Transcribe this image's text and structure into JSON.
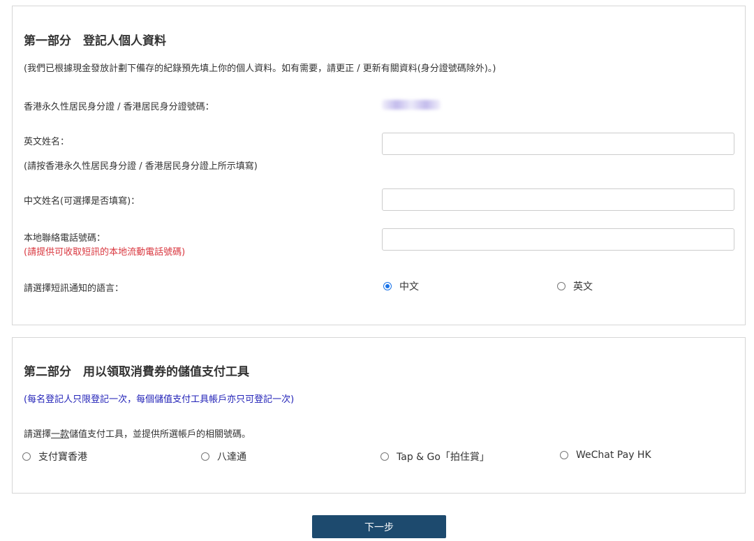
{
  "section1": {
    "title": "第一部分　登記人個人資料",
    "note": "(我們已根據現金發放計劃下備存的紀錄預先填上你的個人資料。如有需要，請更正 / 更新有關資料(身分證號碼除外)。)",
    "id_label": "香港永久性居民身分證 / 香港居民身分證號碼：",
    "english_name_label": "英文姓名：",
    "english_name_hint": "(請按香港永久性居民身分證 / 香港居民身分證上所示填寫)",
    "english_name_value": "",
    "chinese_name_label": "中文姓名(可選擇是否填寫)：",
    "chinese_name_value": "",
    "phone_label": "本地聯絡電話號碼：",
    "phone_hint": "(請提供可收取短訊的本地流動電話號碼)",
    "phone_value": "",
    "sms_language_label": "請選擇短訊通知的語言：",
    "sms_language_options": [
      "中文",
      "英文"
    ],
    "sms_language_selected": "中文"
  },
  "section2": {
    "title": "第二部分　用以領取消費券的儲值支付工具",
    "note": "(每名登記人只限登記一次，每個儲值支付工具帳戶亦只可登記一次)",
    "instruction_pre": "請選擇",
    "instruction_emph": "一款",
    "instruction_post": "儲值支付工具，並提供所選帳戶的相關號碼。",
    "payment_options": [
      "支付寶香港",
      "八達通",
      "Tap & Go「拍住賞」",
      "WeChat Pay HK"
    ]
  },
  "next_button": "下一步",
  "colors": {
    "accent_button": "#1d4a6e",
    "warning_text": "#d9363e",
    "info_text": "#2323b8",
    "radio_selected": "#1a73e8"
  }
}
